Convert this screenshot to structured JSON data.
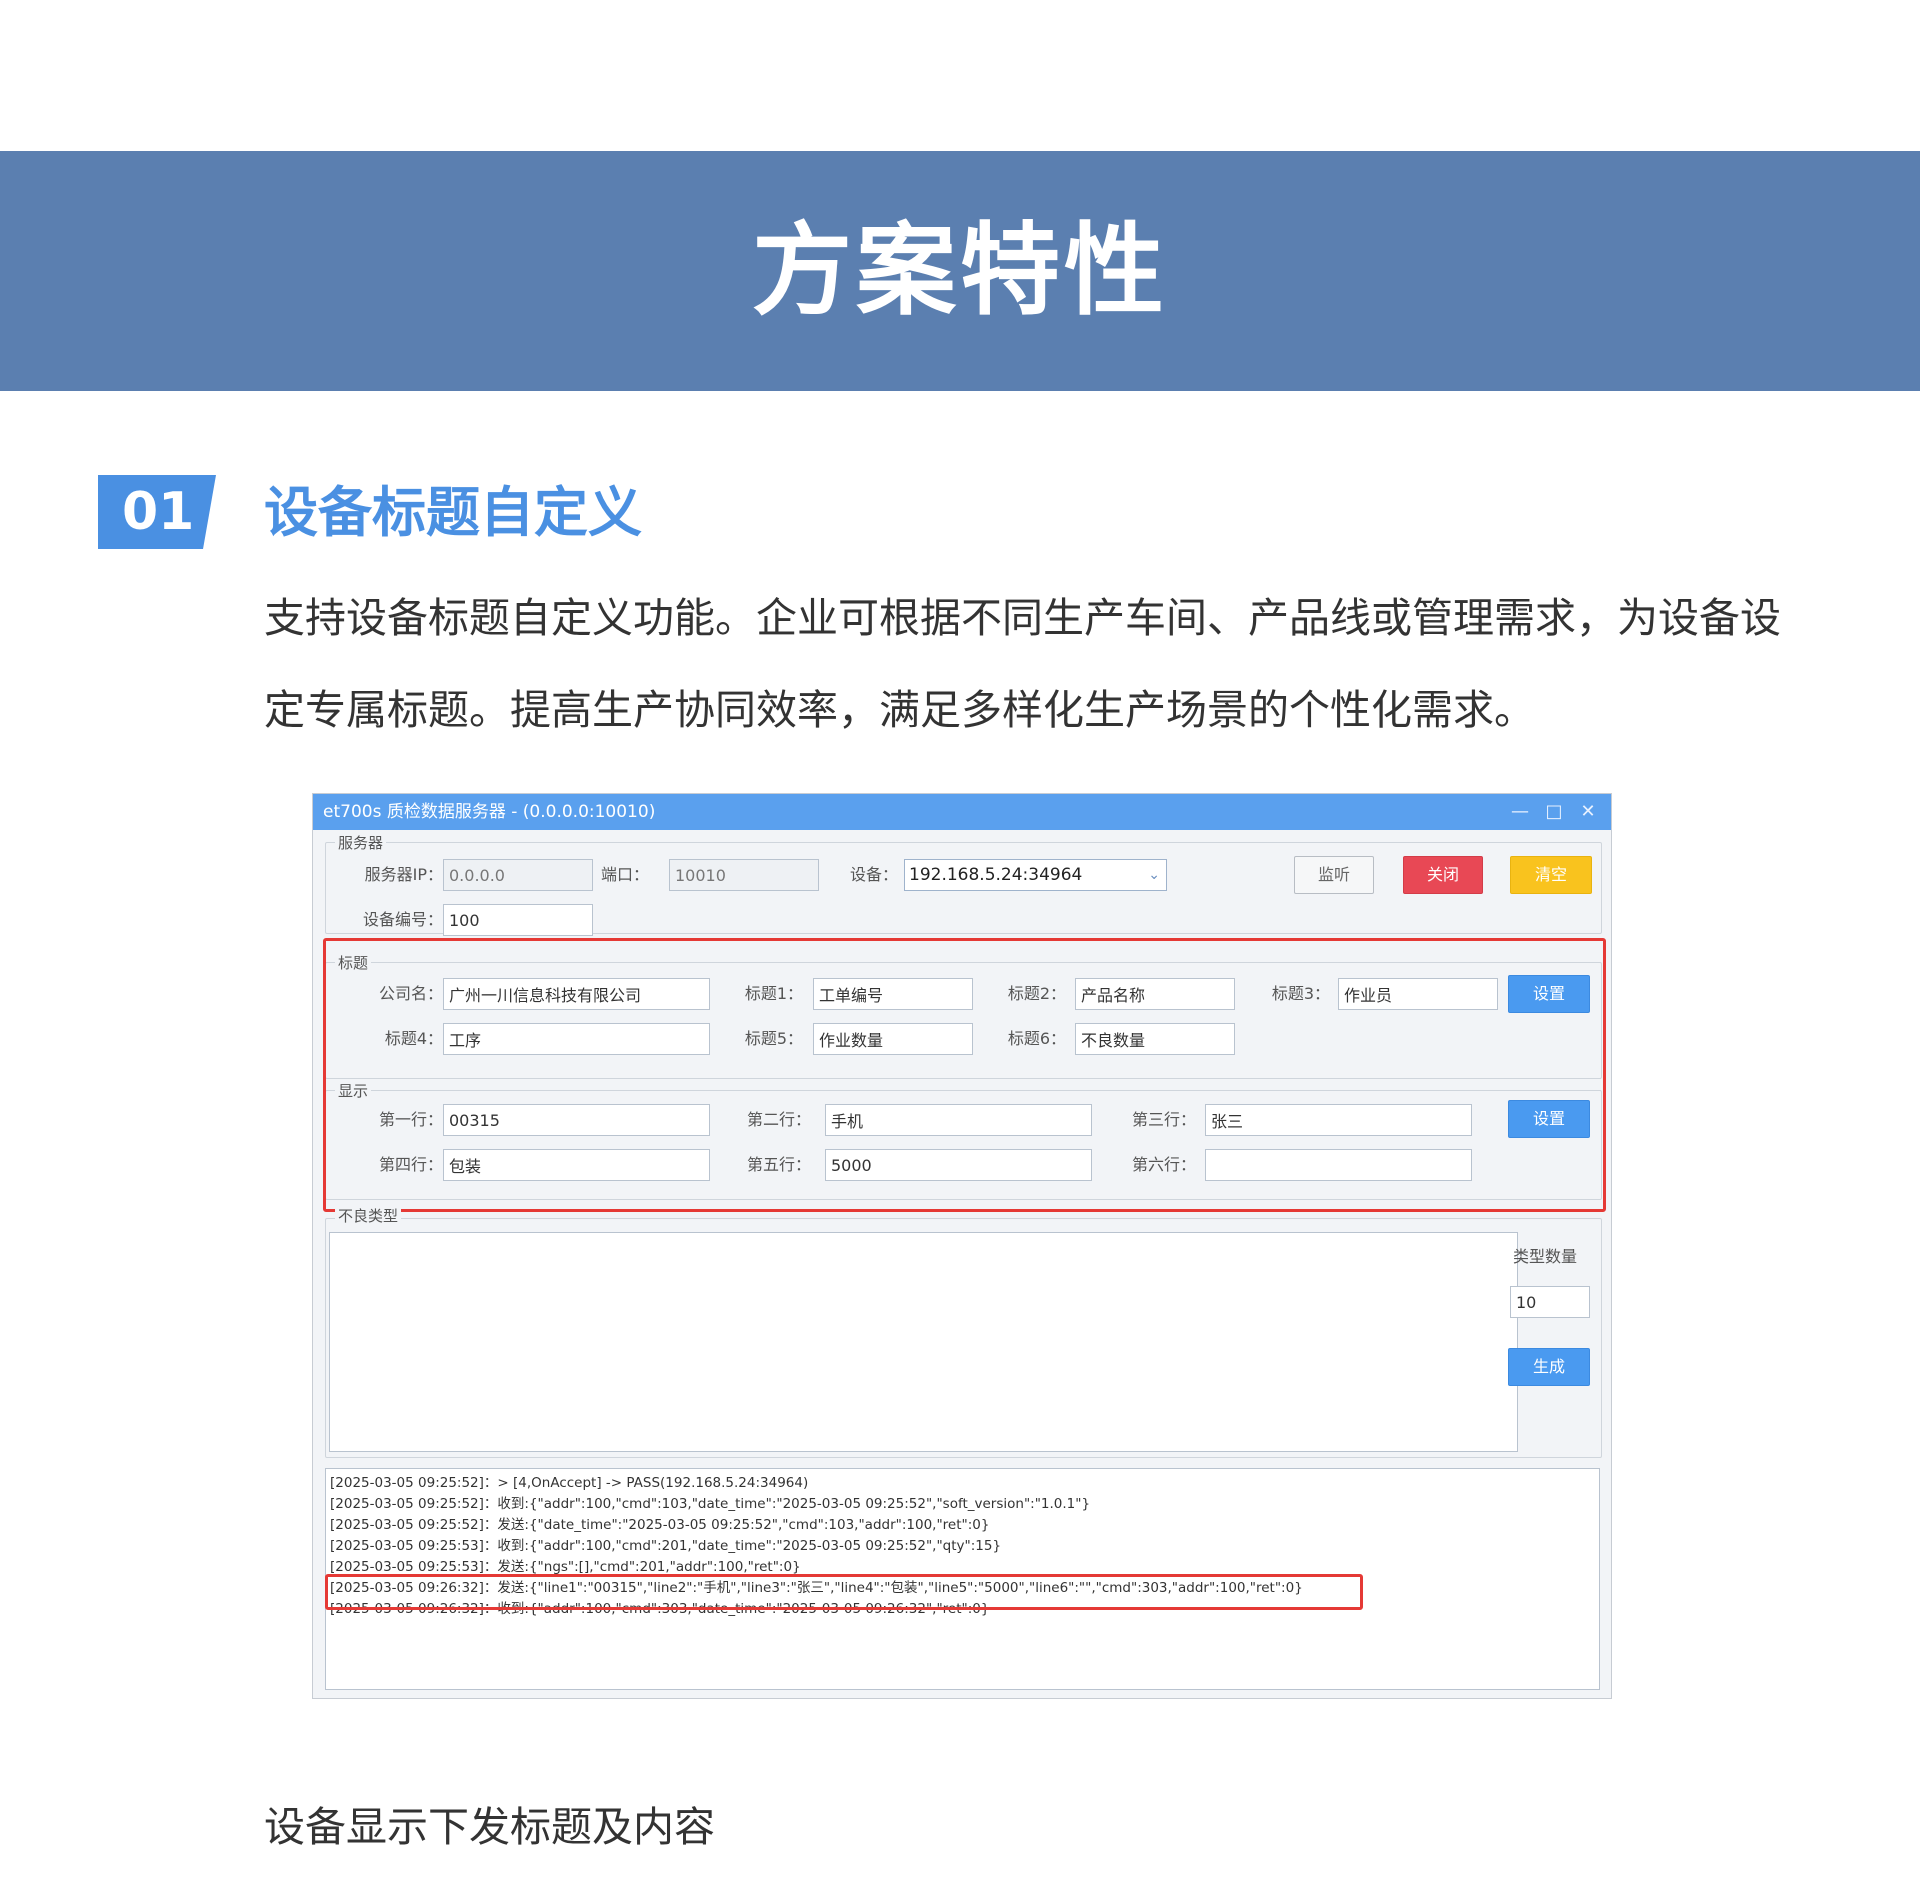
{
  "header": {
    "title": "方案特性"
  },
  "section": {
    "number": "01",
    "title": "设备标题自定义",
    "desc_line1": "支持设备标题自定义功能。企业可根据不同生产车间、产品线或管理需求，为设备设",
    "desc_line2": "定专属标题。提高生产协同效率，满足多样化生产场景的个性化需求。"
  },
  "caption": "设备显示下发标题及内容",
  "window": {
    "title": "et700s 质检数据服务器 - (0.0.0.0:10010)",
    "controls": {
      "minimize": "—",
      "maximize": "□",
      "close": "✕"
    },
    "server": {
      "legend": "服务器",
      "ip_label": "服务器IP：",
      "ip_value": "0.0.0.0",
      "port_label": "端口：",
      "port_value": "10010",
      "device_label": "设备：",
      "device_value": "192.168.5.24:34964",
      "device_no_label": "设备编号：",
      "device_no_value": "100",
      "listen_btn": "监听",
      "close_btn": "关闭",
      "clear_btn": "清空"
    },
    "titles": {
      "legend": "标题",
      "company_label": "公司名：",
      "company_value": "广州一川信息科技有限公司",
      "t1_label": "标题1：",
      "t1_value": "工单编号",
      "t2_label": "标题2：",
      "t2_value": "产品名称",
      "t3_label": "标题3：",
      "t3_value": "作业员",
      "t4_label": "标题4：",
      "t4_value": "工序",
      "t5_label": "标题5：",
      "t5_value": "作业数量",
      "t6_label": "标题6：",
      "t6_value": "不良数量",
      "set_btn": "设置"
    },
    "display": {
      "legend": "显示",
      "l1_label": "第一行：",
      "l1_value": "00315",
      "l2_label": "第二行：",
      "l2_value": "手机",
      "l3_label": "第三行：",
      "l3_value": "张三",
      "l4_label": "第四行：",
      "l4_value": "包装",
      "l5_label": "第五行：",
      "l5_value": "5000",
      "l6_label": "第六行：",
      "l6_value": "",
      "set_btn": "设置"
    },
    "defects": {
      "legend": "不良类型",
      "count_label": "类型数量",
      "count_value": "10",
      "generate_btn": "生成"
    },
    "log": [
      "[2025-03-05 09:25:52]：> [4,OnAccept] -> PASS(192.168.5.24:34964)",
      "[2025-03-05 09:25:52]：收到:{\"addr\":100,\"cmd\":103,\"date_time\":\"2025-03-05 09:25:52\",\"soft_version\":\"1.0.1\"}",
      "[2025-03-05 09:25:52]：发送:{\"date_time\":\"2025-03-05 09:25:52\",\"cmd\":103,\"addr\":100,\"ret\":0}",
      "[2025-03-05 09:25:53]：收到:{\"addr\":100,\"cmd\":201,\"date_time\":\"2025-03-05 09:25:52\",\"qty\":15}",
      "[2025-03-05 09:25:53]：发送:{\"ngs\":[],\"cmd\":201,\"addr\":100,\"ret\":0}",
      "[2025-03-05 09:26:32]：发送:{\"line1\":\"00315\",\"line2\":\"手机\",\"line3\":\"张三\",\"line4\":\"包装\",\"line5\":\"5000\",\"line6\":\"\",\"cmd\":303,\"addr\":100,\"ret\":0}",
      "[2025-03-05 09:26:32]：收到:{\"addr\":100,\"cmd\":303,\"date_time\":\"2025-03-05 09:26:32\",\"ret\":0}"
    ]
  },
  "colors": {
    "banner": "#5b7fb0",
    "accent": "#4a90e2",
    "highlight": "#e53935",
    "titlebar": "#5aa0ee"
  }
}
